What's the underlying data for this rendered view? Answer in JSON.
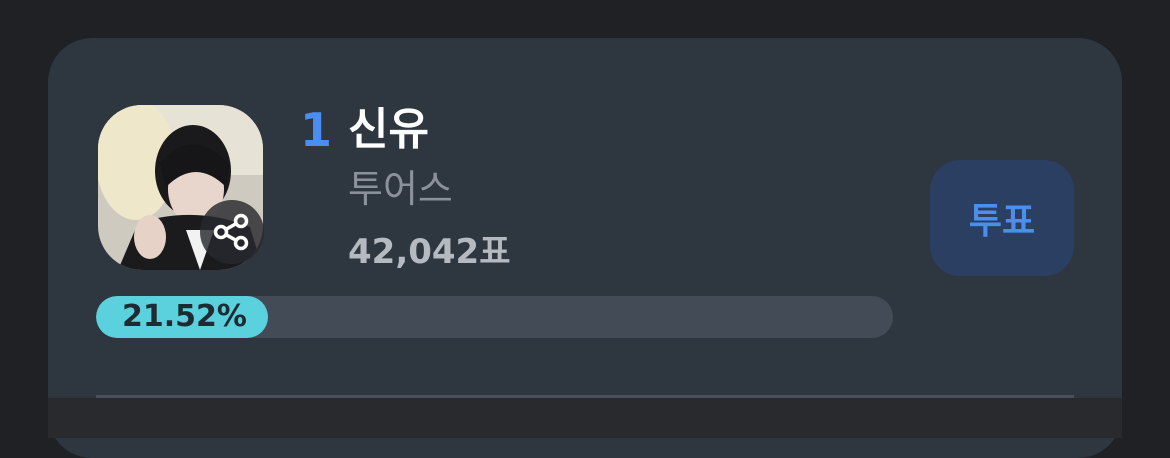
{
  "candidate": {
    "rank": "1",
    "name": "신유",
    "group": "투어스",
    "votes": "42,042표",
    "percent_label": "21.52%",
    "percent_value": 21.52
  },
  "vote_button": {
    "label": "투표"
  },
  "icons": {
    "share": "share-icon",
    "avatar": "profile-photo"
  },
  "colors": {
    "background": "#1f2124",
    "card": "#2e3640",
    "accent": "#4a8ff0",
    "vote_button_bg": "#2b3f63",
    "progress_fill": "#5ad1dd",
    "progress_track": "#434b56"
  }
}
